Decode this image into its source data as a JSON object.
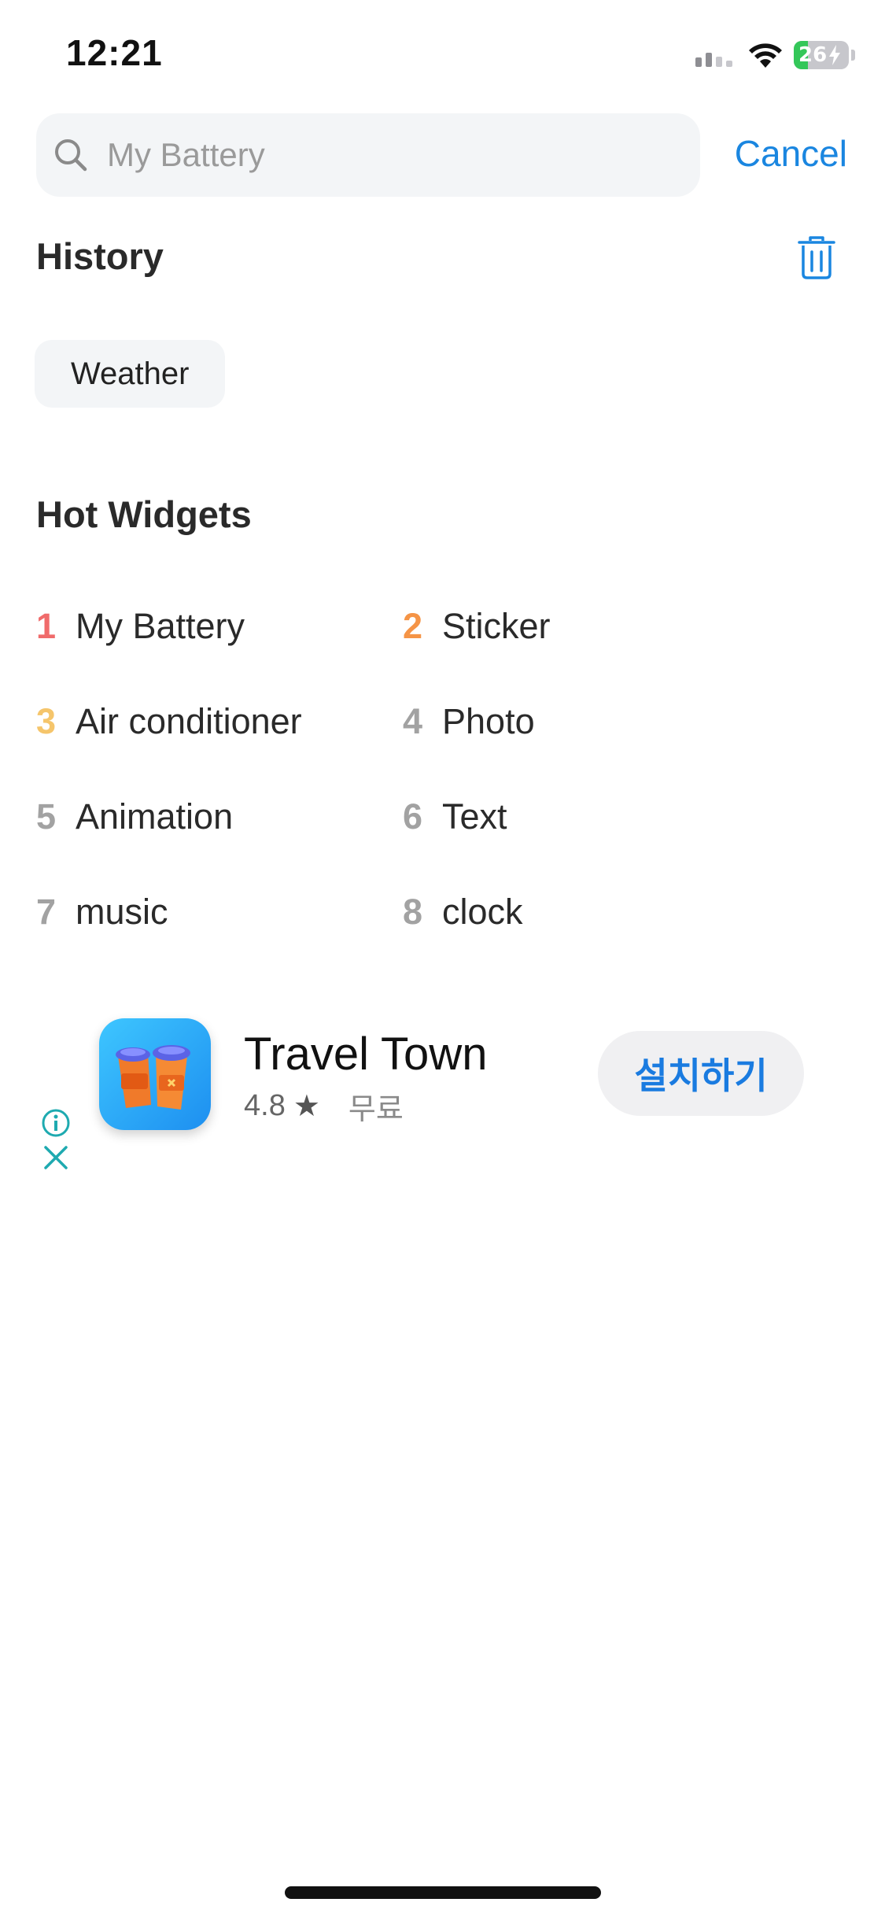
{
  "status_bar": {
    "time": "12:21",
    "battery_level": "26",
    "battery_fraction": 0.26,
    "icons": [
      "cellular-signal-icon",
      "wifi-icon",
      "battery-charging-icon"
    ]
  },
  "search": {
    "placeholder": "My Battery",
    "value": "",
    "cancel_label": "Cancel"
  },
  "history": {
    "title": "History",
    "items": [
      "Weather"
    ]
  },
  "hot_widgets": {
    "title": "Hot Widgets",
    "items": [
      {
        "rank": "1",
        "label": "My Battery",
        "rank_color": "#f06b6b"
      },
      {
        "rank": "2",
        "label": "Sticker",
        "rank_color": "#f59446"
      },
      {
        "rank": "3",
        "label": "Air conditioner",
        "rank_color": "#f5c56b"
      },
      {
        "rank": "4",
        "label": "Photo",
        "rank_color": "#a2a2a2"
      },
      {
        "rank": "5",
        "label": "Animation",
        "rank_color": "#a2a2a2"
      },
      {
        "rank": "6",
        "label": "Text",
        "rank_color": "#a2a2a2"
      },
      {
        "rank": "7",
        "label": "music",
        "rank_color": "#a2a2a2"
      },
      {
        "rank": "8",
        "label": "clock",
        "rank_color": "#a2a2a2"
      }
    ]
  },
  "ad": {
    "app_name": "Travel Town",
    "rating": "4.8",
    "price": "무료",
    "install_label": "설치하기"
  },
  "colors": {
    "accent": "#1a86e0",
    "ad_accent": "#1eaab0"
  }
}
